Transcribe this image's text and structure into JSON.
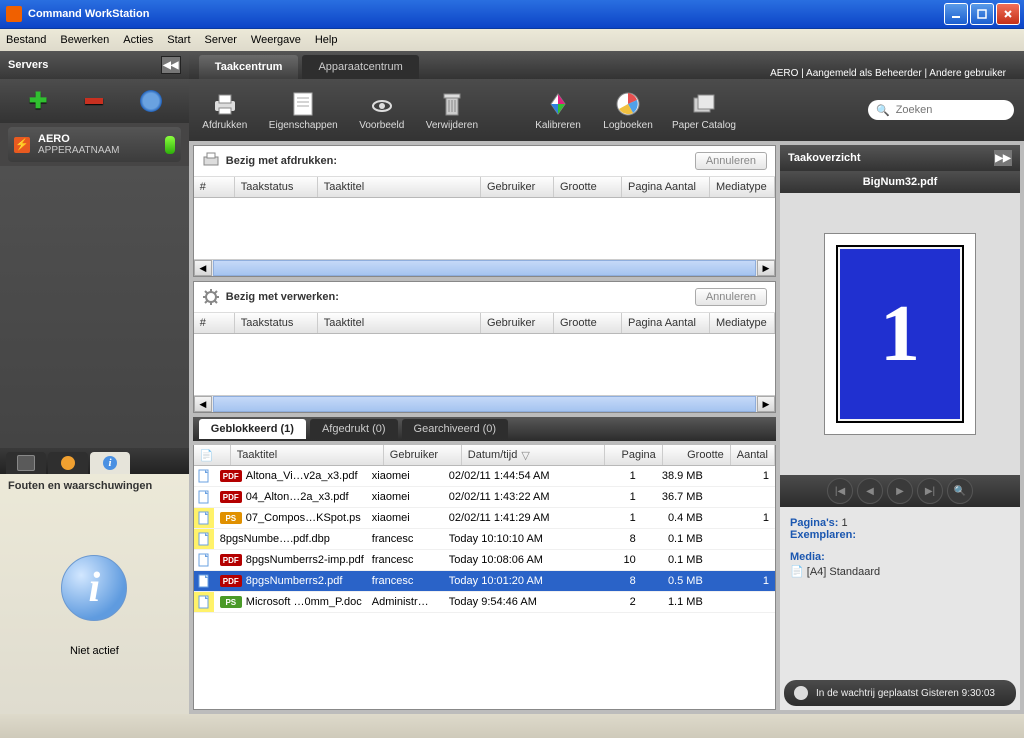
{
  "window": {
    "title": "Command WorkStation"
  },
  "menu": [
    "Bestand",
    "Bewerken",
    "Acties",
    "Start",
    "Server",
    "Weergave",
    "Help"
  ],
  "sidebar": {
    "title": "Servers",
    "server": {
      "name": "AERO",
      "sub": "APPERAATNAAM"
    },
    "errors_title": "Fouten en waarschuwingen",
    "errors_status": "Niet actief"
  },
  "tabs": {
    "main": "Taakcentrum",
    "other": "Apparaatcentrum"
  },
  "login": {
    "server": "AERO",
    "logged_as": "Aangemeld als Beheerder",
    "switch": "Andere gebruiker"
  },
  "toolbar": {
    "print": "Afdrukken",
    "properties": "Eigenschappen",
    "preview": "Voorbeeld",
    "delete": "Verwijderen",
    "calibrate": "Kalibreren",
    "logs": "Logboeken",
    "papercatalog": "Paper Catalog",
    "search_placeholder": "Zoeken"
  },
  "printing": {
    "title": "Bezig met afdrukken:",
    "cancel": "Annuleren",
    "cols": {
      "num": "#",
      "status": "Taakstatus",
      "title": "Taaktitel",
      "user": "Gebruiker",
      "size": "Grootte",
      "pages": "Pagina Aantal",
      "media": "Mediatype"
    }
  },
  "processing": {
    "title": "Bezig met verwerken:",
    "cancel": "Annuleren",
    "cols": {
      "num": "#",
      "status": "Taakstatus",
      "title": "Taaktitel",
      "user": "Gebruiker",
      "size": "Grootte",
      "pages": "Pagina Aantal",
      "media": "Mediatype"
    }
  },
  "held": {
    "tabs": {
      "blocked": "Geblokkeerd (1)",
      "printed": "Afgedrukt (0)",
      "archived": "Gearchiveerd (0)"
    },
    "cols": {
      "title": "Taaktitel",
      "user": "Gebruiker",
      "datetime": "Datum/tijd",
      "pages": "Pagina",
      "size": "Grootte",
      "copies": "Aantal"
    },
    "rows": [
      {
        "badge": "PDF",
        "bcolor": "red",
        "title": "Altona_Vi…v2a_x3.pdf",
        "user": "xiaomei",
        "datetime": "02/02/11  1:44:54 AM",
        "pages": 1,
        "size": "38.9 MB",
        "copies": 1,
        "highlight": false
      },
      {
        "badge": "PDF",
        "bcolor": "red",
        "title": "04_Alton…2a_x3.pdf",
        "user": "xiaomei",
        "datetime": "02/02/11  1:43:22 AM",
        "pages": 1,
        "size": "36.7 MB",
        "copies": "",
        "highlight": false
      },
      {
        "badge": "PS",
        "bcolor": "orange",
        "title": "07_Compos…KSpot.ps",
        "user": "xiaomei",
        "datetime": "02/02/11  1:41:29 AM",
        "pages": 1,
        "size": "0.4 MB",
        "copies": 1,
        "highlight": true
      },
      {
        "badge": "",
        "bcolor": "",
        "title": "8pgsNumbe….pdf.dbp",
        "user": "francesc",
        "datetime": "Today 10:10:10 AM",
        "pages": 8,
        "size": "0.1 MB",
        "copies": "",
        "highlight": true
      },
      {
        "badge": "PDF",
        "bcolor": "red",
        "title": "8pgsNumberrs2-imp.pdf",
        "user": "francesc",
        "datetime": "Today 10:08:06 AM",
        "pages": 10,
        "size": "0.1 MB",
        "copies": "",
        "highlight": false
      },
      {
        "badge": "PDF",
        "bcolor": "red",
        "title": "8pgsNumberrs2.pdf",
        "user": "francesc",
        "datetime": "Today 10:01:20 AM",
        "pages": 8,
        "size": "0.5 MB",
        "copies": 1,
        "highlight": false,
        "selected": true
      },
      {
        "badge": "PS",
        "bcolor": "green",
        "title": "Microsoft …0mm_P.doc",
        "user": "Administr…",
        "datetime": "Today 9:54:46 AM",
        "pages": 2,
        "size": "1.1 MB",
        "copies": "",
        "highlight": true
      }
    ]
  },
  "overview": {
    "title": "Taakoverzicht",
    "filename": "BigNum32.pdf",
    "page_number": "1",
    "pages_label": "Pagina's:",
    "pages_value": "1",
    "copies_label": "Exemplaren:",
    "media_label": "Media:",
    "media_value": "[A4] Standaard",
    "queue_status": "In de wachtrij geplaatst Gisteren  9:30:03"
  }
}
